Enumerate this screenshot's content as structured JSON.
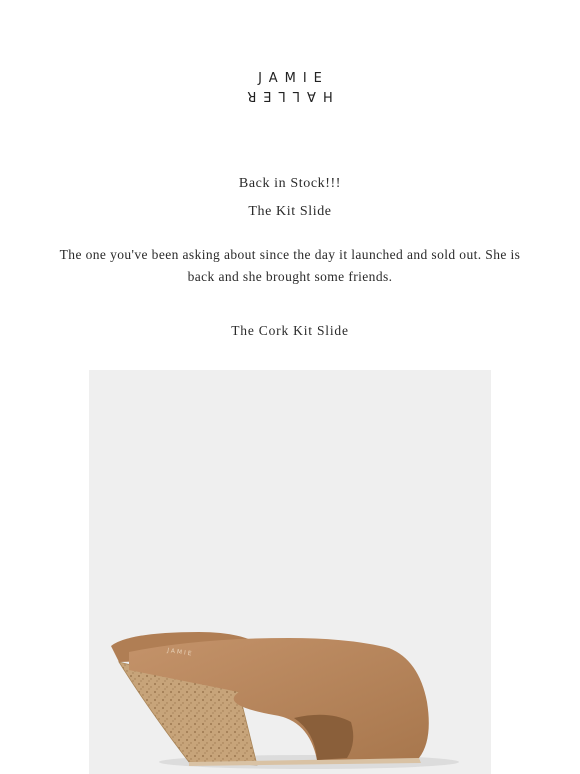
{
  "brand": {
    "line1": "JAMIE",
    "line2": "HALLER"
  },
  "headline": {
    "line1": "Back in Stock!!!",
    "line2": "The Kit Slide"
  },
  "body": {
    "line1": "The one you've been asking about since the day it launched and sold out. She is",
    "line2": "back and she brought some friends."
  },
  "product": {
    "title": "The Cork Kit Slide",
    "image_alt": "tan leather wedge slide with cork heel"
  },
  "colors": {
    "leather": "#b9875c",
    "cork": "#c7a47a",
    "background": "#efefef"
  }
}
